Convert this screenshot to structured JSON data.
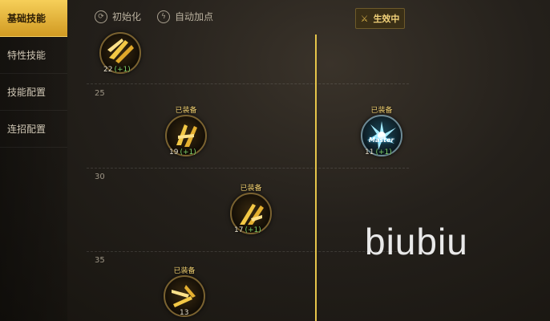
{
  "nav": {
    "items": [
      {
        "label": "基础技能",
        "active": true
      },
      {
        "label": "特性技能",
        "active": false
      },
      {
        "label": "技能配置",
        "active": false
      },
      {
        "label": "连招配置",
        "active": false
      }
    ]
  },
  "toolbar": {
    "reset_label": "初始化",
    "auto_label": "自动加点",
    "effect_label": "生效中"
  },
  "levels": [
    "25",
    "30",
    "35"
  ],
  "skills": [
    {
      "level": "22",
      "bonus": "(+1)",
      "equipped": ""
    },
    {
      "level": "19",
      "bonus": "(+1)",
      "equipped": "已装备"
    },
    {
      "level": "11",
      "bonus": "(+1)",
      "equipped": "已装备",
      "master": "Master"
    },
    {
      "level": "17",
      "bonus": "(+1)",
      "equipped": "已装备"
    },
    {
      "level": "13",
      "bonus": "",
      "equipped": "已装备"
    }
  ],
  "watermark": "biubiu",
  "colors": {
    "accent": "#e5c44a",
    "bonus": "#7fd36b"
  }
}
